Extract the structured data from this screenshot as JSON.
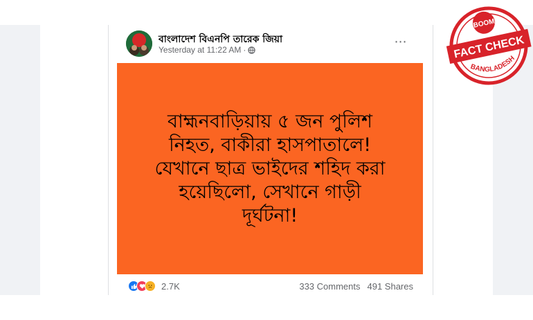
{
  "post": {
    "page_name": "বাংলাদেশ বিএনপি তারেক জিয়া",
    "timestamp": "Yesterday at 11:22 AM",
    "separator": "·",
    "more_icon": "⋯",
    "text_lines": [
      "বাহ্মনবাড়িয়ায় ৫ জন পুলিশ",
      "নিহত, বাকীরা হাসপাতালে!",
      "যেখানে ছাত্র ভাইদের শহিদ করা",
      "হয়েছিলো, সেখানে গাড়ী",
      "দূর্ঘটনা!"
    ],
    "panel_color": "#fb6522",
    "reaction_count": "2.7K",
    "comments": "333 Comments",
    "shares": "491 Shares"
  },
  "stamp": {
    "top_text": "BOOM",
    "main_text": "FACT CHECK",
    "bottom_text": "BANGLADESH",
    "color": "#d8232a"
  }
}
